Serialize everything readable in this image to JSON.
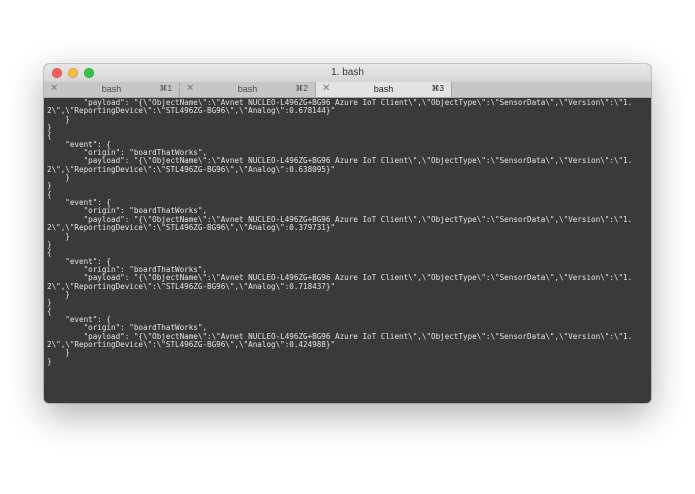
{
  "window": {
    "title": "1. bash"
  },
  "tabs": [
    {
      "label": "bash",
      "shortcut": "⌘1",
      "active": false
    },
    {
      "label": "bash",
      "shortcut": "⌘2",
      "active": false
    },
    {
      "label": "bash",
      "shortcut": "⌘3",
      "active": true
    }
  ],
  "terminal": {
    "lines": [
      "        \"payload\": \"{\\\"ObjectName\\\":\\\"Avnet NUCLEO-L496ZG+BG96 Azure IoT Client\\\",\\\"ObjectType\\\":\\\"SensorData\\\",\\\"Version\\\":\\\"1.",
      "2\\\",\\\"ReportingDevice\\\":\\\"STL496ZG-BG96\\\",\\\"Analog\\\":0.678144}\"",
      "    }",
      "}",
      "{",
      "    \"event\": {",
      "        \"origin\": \"boardThatWorks\",",
      "        \"payload\": \"{\\\"ObjectName\\\":\\\"Avnet NUCLEO-L496ZG+BG96 Azure IoT Client\\\",\\\"ObjectType\\\":\\\"SensorData\\\",\\\"Version\\\":\\\"1.",
      "2\\\",\\\"ReportingDevice\\\":\\\"STL496ZG-BG96\\\",\\\"Analog\\\":0.638095}\"",
      "    }",
      "}",
      "{",
      "    \"event\": {",
      "        \"origin\": \"boardThatWorks\",",
      "        \"payload\": \"{\\\"ObjectName\\\":\\\"Avnet NUCLEO-L496ZG+BG96 Azure IoT Client\\\",\\\"ObjectType\\\":\\\"SensorData\\\",\\\"Version\\\":\\\"1.",
      "2\\\",\\\"ReportingDevice\\\":\\\"STL496ZG-BG96\\\",\\\"Analog\\\":0.379731}\"",
      "    }",
      "}",
      "{",
      "    \"event\": {",
      "        \"origin\": \"boardThatWorks\",",
      "        \"payload\": \"{\\\"ObjectName\\\":\\\"Avnet NUCLEO-L496ZG+BG96 Azure IoT Client\\\",\\\"ObjectType\\\":\\\"SensorData\\\",\\\"Version\\\":\\\"1.",
      "2\\\",\\\"ReportingDevice\\\":\\\"STL496ZG-BG96\\\",\\\"Analog\\\":0.718437}\"",
      "    }",
      "}",
      "{",
      "    \"event\": {",
      "        \"origin\": \"boardThatWorks\",",
      "        \"payload\": \"{\\\"ObjectName\\\":\\\"Avnet NUCLEO-L496ZG+BG96 Azure IoT Client\\\",\\\"ObjectType\\\":\\\"SensorData\\\",\\\"Version\\\":\\\"1.",
      "2\\\",\\\"ReportingDevice\\\":\\\"STL496ZG-BG96\\\",\\\"Analog\\\":0.424988}\"",
      "    }",
      "}"
    ]
  }
}
